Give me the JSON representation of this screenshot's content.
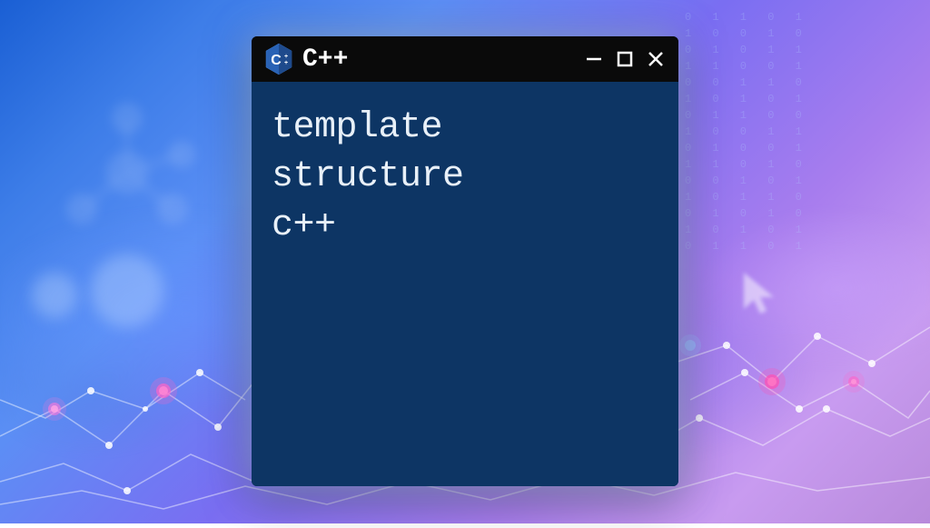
{
  "window": {
    "title": "C++",
    "controls": {
      "minimize": "minimize",
      "maximize": "maximize",
      "close": "close"
    }
  },
  "terminal": {
    "lines": {
      "0": "template",
      "1": "structure",
      "2": "c++"
    }
  },
  "colors": {
    "terminal_bg": "#0d3564",
    "titlebar_bg": "#0a0a0a",
    "text": "#e8f0f8",
    "accent": "#5a8dd8"
  },
  "icons": {
    "app": "cpp-hexagon"
  }
}
